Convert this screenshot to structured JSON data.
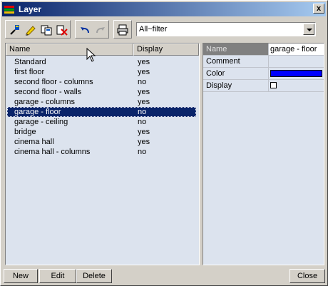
{
  "window": {
    "title": "Layer",
    "close_symbol": "x"
  },
  "toolbar": {
    "icons": [
      "new-layer-icon",
      "rename-icon",
      "copy-layer-icon",
      "delete-layer-icon",
      "undo-icon",
      "redo-icon",
      "print-icon"
    ],
    "filter": {
      "value": "All~filter"
    }
  },
  "layers": {
    "columns": [
      "Name",
      "Display"
    ],
    "rows": [
      {
        "name": "Standard",
        "display": "yes"
      },
      {
        "name": "first floor",
        "display": "yes"
      },
      {
        "name": "second floor - columns",
        "display": "no"
      },
      {
        "name": "second floor - walls",
        "display": "yes"
      },
      {
        "name": "garage - columns",
        "display": "yes"
      },
      {
        "name": "garage - floor",
        "display": "no",
        "selected": true
      },
      {
        "name": "garage - ceiling",
        "display": "no"
      },
      {
        "name": "bridge",
        "display": "yes"
      },
      {
        "name": "cinema hall",
        "display": "yes"
      },
      {
        "name": "cinema hall - columns",
        "display": "no"
      }
    ]
  },
  "properties": {
    "head": {
      "label": "Name",
      "value": "garage - floor"
    },
    "comment": {
      "label": "Comment",
      "value": ""
    },
    "color": {
      "label": "Color",
      "value": "#0000ff"
    },
    "display": {
      "label": "Display",
      "checked": false
    }
  },
  "buttons": {
    "new": "New",
    "edit": "Edit",
    "delete": "Delete",
    "close": "Close"
  }
}
